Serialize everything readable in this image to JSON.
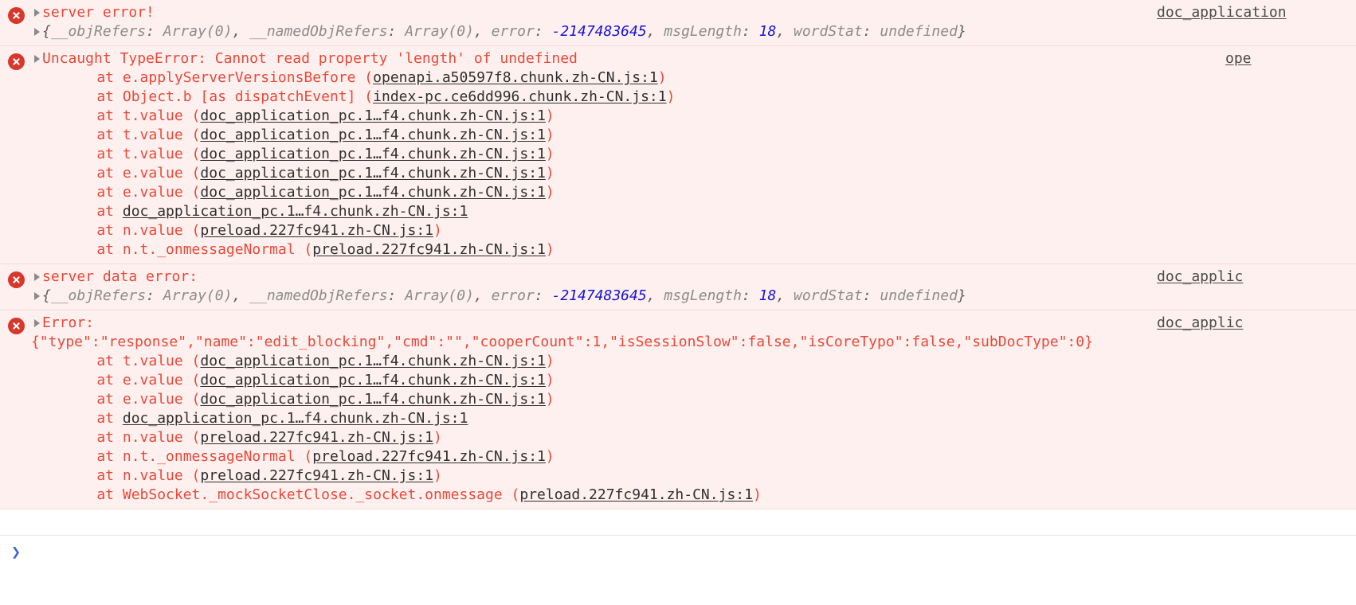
{
  "console": {
    "messages": [
      {
        "icon": "error-circle-icon",
        "disclosure": "disclosure-triangle-icon",
        "title": "server error!",
        "preview": {
          "open": "{",
          "k1": "__objRefers",
          "v1": "Array(0)",
          "k2": "__namedObjRefers",
          "v2": "Array(0)",
          "k3": "error",
          "v3": "-2147483645",
          "k4": "msgLength",
          "v4": "18",
          "k5": "wordStat",
          "v5": "undefined",
          "close": "}"
        },
        "source": "doc_application"
      },
      {
        "icon": "error-circle-icon",
        "disclosure": "disclosure-triangle-icon",
        "title": "Uncaught TypeError: Cannot read property 'length' of undefined",
        "source": "ope",
        "frames": [
          {
            "at": "    at e.applyServerVersionsBefore (",
            "link": "openapi.a50597f8.chunk.zh-CN.js:1",
            "tail": ")"
          },
          {
            "at": "    at Object.b [as dispatchEvent] (",
            "link": "index-pc.ce6dd996.chunk.zh-CN.js:1",
            "tail": ")"
          },
          {
            "at": "    at t.value (",
            "link": "doc_application_pc.1…f4.chunk.zh-CN.js:1",
            "tail": ")"
          },
          {
            "at": "    at t.value (",
            "link": "doc_application_pc.1…f4.chunk.zh-CN.js:1",
            "tail": ")"
          },
          {
            "at": "    at t.value (",
            "link": "doc_application_pc.1…f4.chunk.zh-CN.js:1",
            "tail": ")"
          },
          {
            "at": "    at e.value (",
            "link": "doc_application_pc.1…f4.chunk.zh-CN.js:1",
            "tail": ")"
          },
          {
            "at": "    at e.value (",
            "link": "doc_application_pc.1…f4.chunk.zh-CN.js:1",
            "tail": ")"
          },
          {
            "at": "    at ",
            "link": "doc_application_pc.1…f4.chunk.zh-CN.js:1",
            "tail": ""
          },
          {
            "at": "    at n.value (",
            "link": "preload.227fc941.zh-CN.js:1",
            "tail": ")"
          },
          {
            "at": "    at n.t._onmessageNormal (",
            "link": "preload.227fc941.zh-CN.js:1",
            "tail": ")"
          }
        ]
      },
      {
        "icon": "error-circle-icon",
        "disclosure": "disclosure-triangle-icon",
        "title": "server data error:",
        "preview": {
          "open": "{",
          "k1": "__objRefers",
          "v1": "Array(0)",
          "k2": "__namedObjRefers",
          "v2": "Array(0)",
          "k3": "error",
          "v3": "-2147483645",
          "k4": "msgLength",
          "v4": "18",
          "k5": "wordStat",
          "v5": "undefined",
          "close": "}"
        },
        "source": "doc_applic"
      },
      {
        "icon": "error-circle-icon",
        "disclosure": "disclosure-triangle-icon",
        "title": "Error:",
        "payload": "{\"type\":\"response\",\"name\":\"edit_blocking\",\"cmd\":\"\",\"cooperCount\":1,\"isSessionSlow\":false,\"isCoreTypo\":false,\"subDocType\":0}",
        "source": "doc_applic",
        "frames": [
          {
            "at": "    at t.value (",
            "link": "doc_application_pc.1…f4.chunk.zh-CN.js:1",
            "tail": ")"
          },
          {
            "at": "    at e.value (",
            "link": "doc_application_pc.1…f4.chunk.zh-CN.js:1",
            "tail": ")"
          },
          {
            "at": "    at e.value (",
            "link": "doc_application_pc.1…f4.chunk.zh-CN.js:1",
            "tail": ")"
          },
          {
            "at": "    at ",
            "link": "doc_application_pc.1…f4.chunk.zh-CN.js:1",
            "tail": ""
          },
          {
            "at": "    at n.value (",
            "link": "preload.227fc941.zh-CN.js:1",
            "tail": ")"
          },
          {
            "at": "    at n.t._onmessageNormal (",
            "link": "preload.227fc941.zh-CN.js:1",
            "tail": ")"
          },
          {
            "at": "    at n.value (",
            "link": "preload.227fc941.zh-CN.js:1",
            "tail": ")"
          },
          {
            "at": "    at WebSocket._mockSocketClose._socket.onmessage (",
            "link": "preload.227fc941.zh-CN.js:1",
            "tail": ")"
          }
        ]
      }
    ],
    "prompt": {
      "chevron": "prompt-chevron-icon",
      "value": "",
      "placeholder": ""
    },
    "colors": {
      "error_text": "#e8493a",
      "error_bg": "#fdf0ee",
      "error_border": "#f7dcd7",
      "badge": "#d8382c",
      "number": "#1a12d6",
      "link": "#303030",
      "prompt": "#4066d9"
    }
  }
}
